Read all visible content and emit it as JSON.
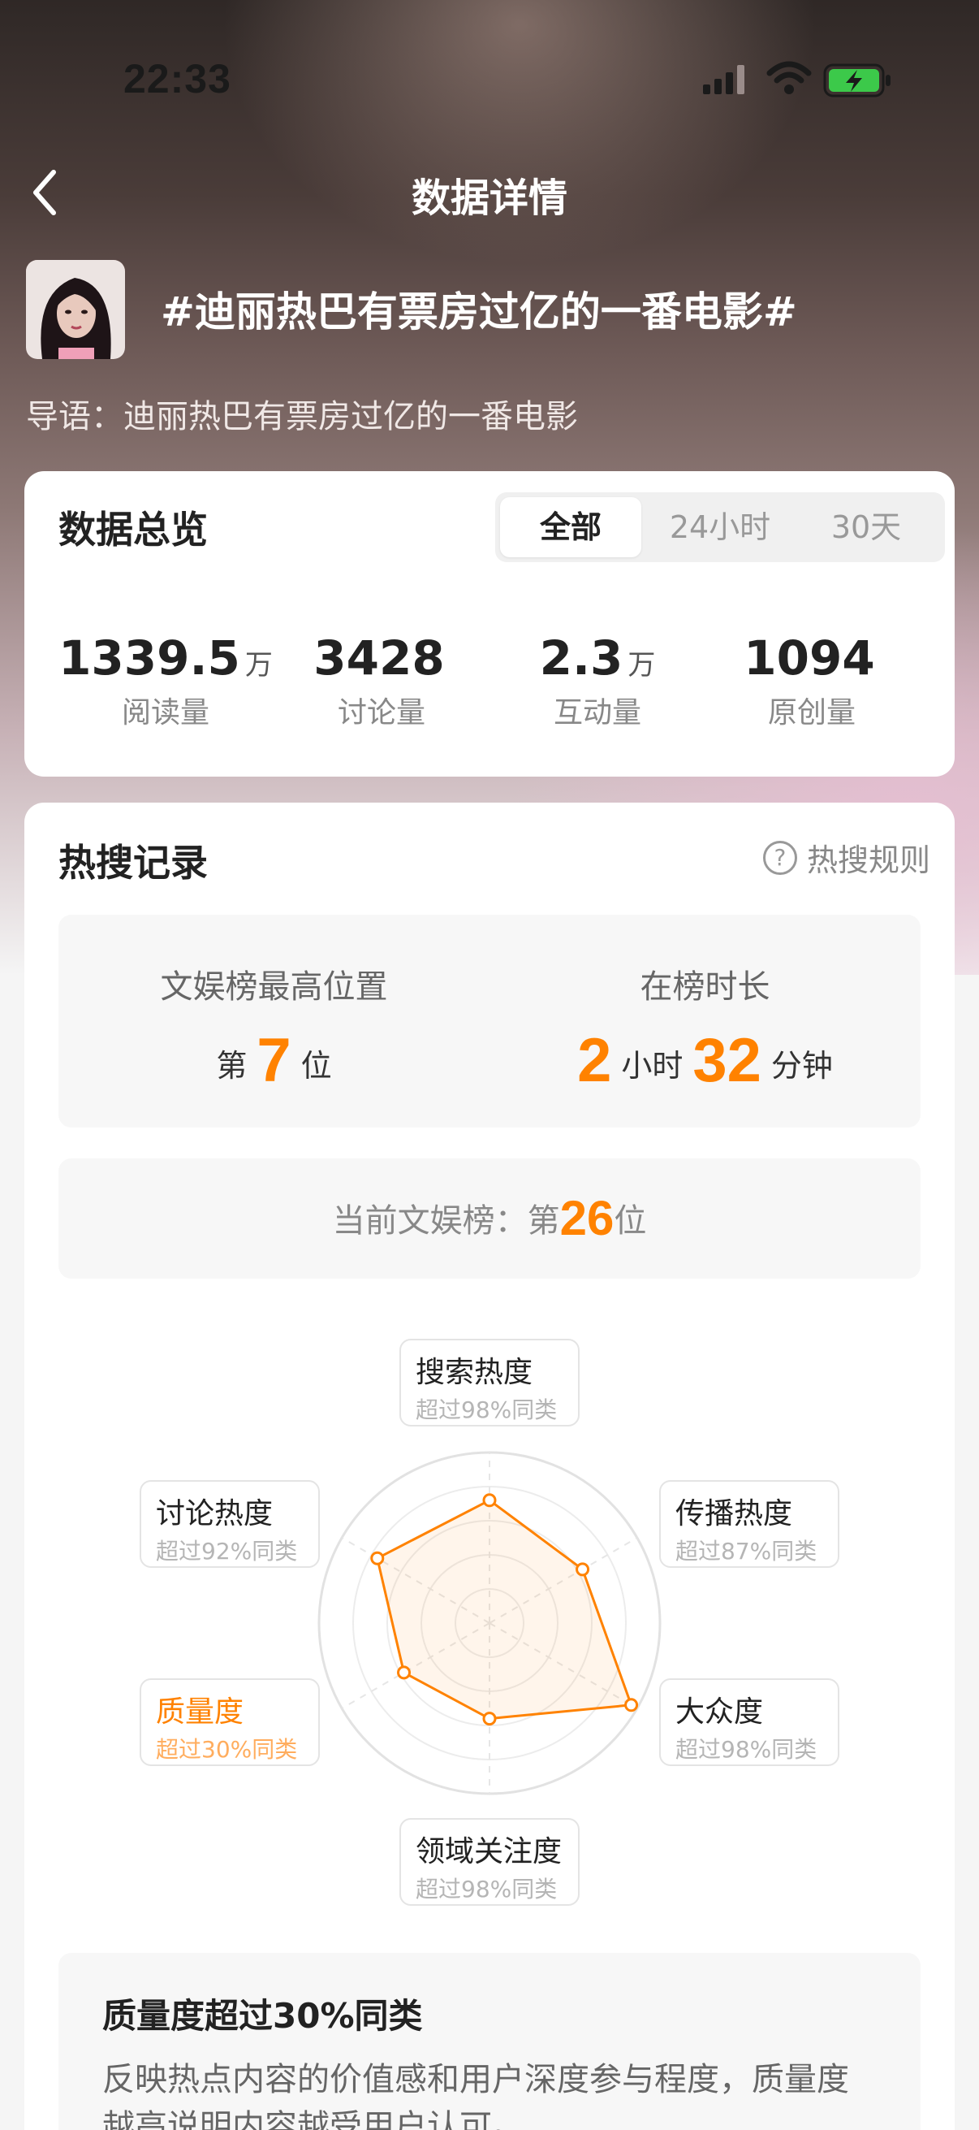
{
  "status": {
    "time": "22:33"
  },
  "nav": {
    "title": "数据详情"
  },
  "topic": {
    "title": "#迪丽热巴有票房过亿的一番电影#",
    "intro": "导语：迪丽热巴有票房过亿的一番电影"
  },
  "overview": {
    "title": "数据总览",
    "tabs": [
      {
        "label": "全部",
        "active": true
      },
      {
        "label": "24小时",
        "active": false
      },
      {
        "label": "30天",
        "active": false
      }
    ],
    "stats": [
      {
        "value": "1339.5",
        "unit": "万",
        "label": "阅读量"
      },
      {
        "value": "3428",
        "unit": "",
        "label": "讨论量"
      },
      {
        "value": "2.3",
        "unit": "万",
        "label": "互动量"
      },
      {
        "value": "1094",
        "unit": "",
        "label": "原创量"
      }
    ]
  },
  "hot_search": {
    "title": "热搜记录",
    "rules_label": "热搜规则",
    "best_rank": {
      "heading": "文娱榜最高位置",
      "prefix": "第",
      "value": "7",
      "suffix": "位"
    },
    "duration": {
      "heading": "在榜时长",
      "hours": "2",
      "hours_unit": "小时",
      "minutes": "32",
      "minutes_unit": "分钟"
    },
    "current": {
      "label": "当前文娱榜：第",
      "value": "26",
      "suffix": "位"
    }
  },
  "radar": {
    "axes": [
      {
        "name": "搜索热度",
        "sub": "超过98%同类",
        "value": 0.72,
        "highlight": false
      },
      {
        "name": "传播热度",
        "sub": "超过87%同类",
        "value": 0.63,
        "highlight": false
      },
      {
        "name": "大众度",
        "sub": "超过98%同类",
        "value": 0.96,
        "highlight": false
      },
      {
        "name": "领域关注度",
        "sub": "超过98%同类",
        "value": 0.56,
        "highlight": false
      },
      {
        "name": "质量度",
        "sub": "超过30%同类",
        "value": 0.58,
        "highlight": true
      },
      {
        "name": "讨论热度",
        "sub": "超过92%同类",
        "value": 0.76,
        "highlight": false
      }
    ],
    "colors": {
      "accent": "#ff8200",
      "fill": "rgba(255,130,0,0.08)"
    }
  },
  "description": {
    "title": "质量度超过30%同类",
    "text": "反映热点内容的价值感和用户深度参与程度，质量度越高说明内容越受用户认可。"
  }
}
